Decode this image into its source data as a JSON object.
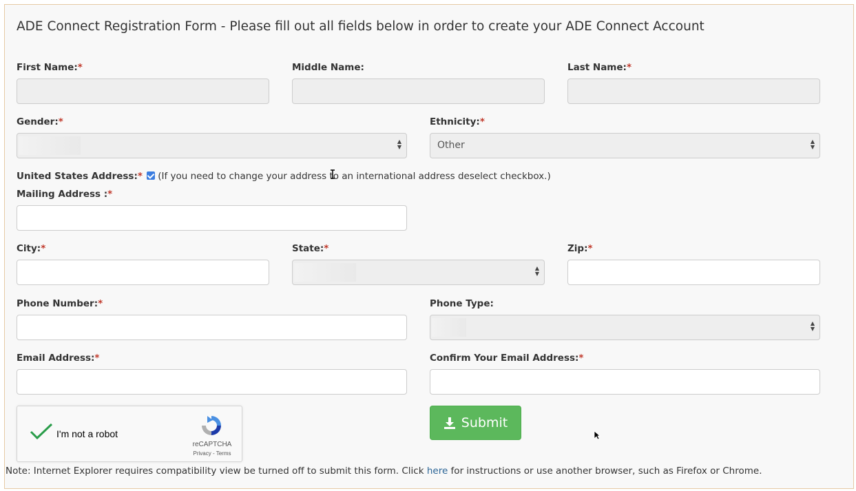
{
  "form": {
    "title": "ADE Connect Registration Form - Please fill out all fields below in order to create your ADE Connect Account",
    "required_marker": "*"
  },
  "fields": {
    "first_name": {
      "label": "First Name:",
      "value": ""
    },
    "middle_name": {
      "label": "Middle Name:",
      "value": ""
    },
    "last_name": {
      "label": "Last Name:",
      "value": ""
    },
    "gender": {
      "label": "Gender:",
      "value": ""
    },
    "ethnicity": {
      "label": "Ethnicity:",
      "value": "Other"
    },
    "us_address": {
      "label": "United States Address:",
      "checked": true,
      "note": "(If you need to change your address to an international address deselect checkbox.)"
    },
    "mailing_address": {
      "label": "Mailing Address :",
      "value": ""
    },
    "city": {
      "label": "City:",
      "value": ""
    },
    "state": {
      "label": "State:",
      "value": ""
    },
    "zip": {
      "label": "Zip:",
      "value": ""
    },
    "phone_number": {
      "label": "Phone Number:",
      "value": ""
    },
    "phone_type": {
      "label": "Phone Type:",
      "value": ""
    },
    "email": {
      "label": "Email Address:",
      "value": ""
    },
    "confirm_email": {
      "label": "Confirm Your Email Address:",
      "value": ""
    }
  },
  "captcha": {
    "label": "I'm not a robot",
    "brand": "reCAPTCHA",
    "links": "Privacy - Terms"
  },
  "submit": {
    "label": "Submit",
    "icon": "download-icon",
    "color": "#5cb85c"
  },
  "note": {
    "before": "Note: Internet Explorer requires compatibility view be turned off to submit this form. Click ",
    "link": "here",
    "after": " for instructions or use another browser, such as Firefox or Chrome."
  },
  "colors": {
    "required": "#c0392b",
    "checkbox": "#3b7de0",
    "link": "#2a6496",
    "panel_border": "#e6c9a4"
  }
}
